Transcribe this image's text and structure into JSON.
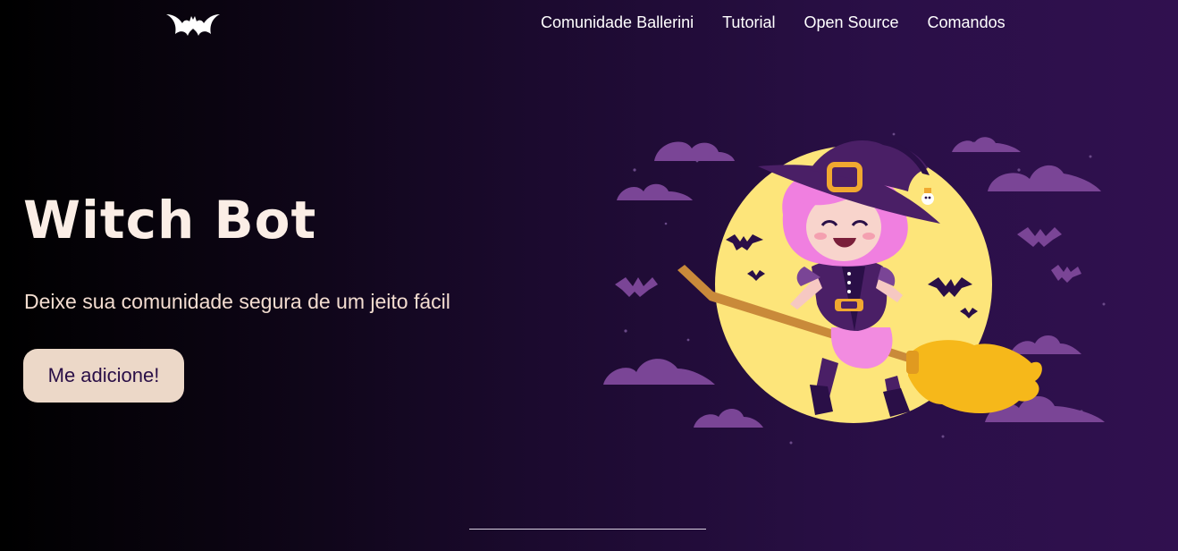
{
  "header": {
    "logo_icon": "bat-icon",
    "nav": [
      {
        "label": "Comunidade Ballerini"
      },
      {
        "label": "Tutorial"
      },
      {
        "label": "Open Source"
      },
      {
        "label": "Comandos"
      }
    ]
  },
  "hero": {
    "title": "Witch Bot",
    "subtitle": "Deixe sua comunidade segura de um jeito fácil",
    "cta_label": "Me adicione!",
    "illustration": "witch-on-broom-illustration"
  },
  "colors": {
    "background_start": "#000000",
    "background_end": "#30104f",
    "title": "#fbeee6",
    "button_bg": "#ecd8c8",
    "button_text": "#2a0f47",
    "moon": "#fde57a",
    "cloud": "#7a4596"
  }
}
